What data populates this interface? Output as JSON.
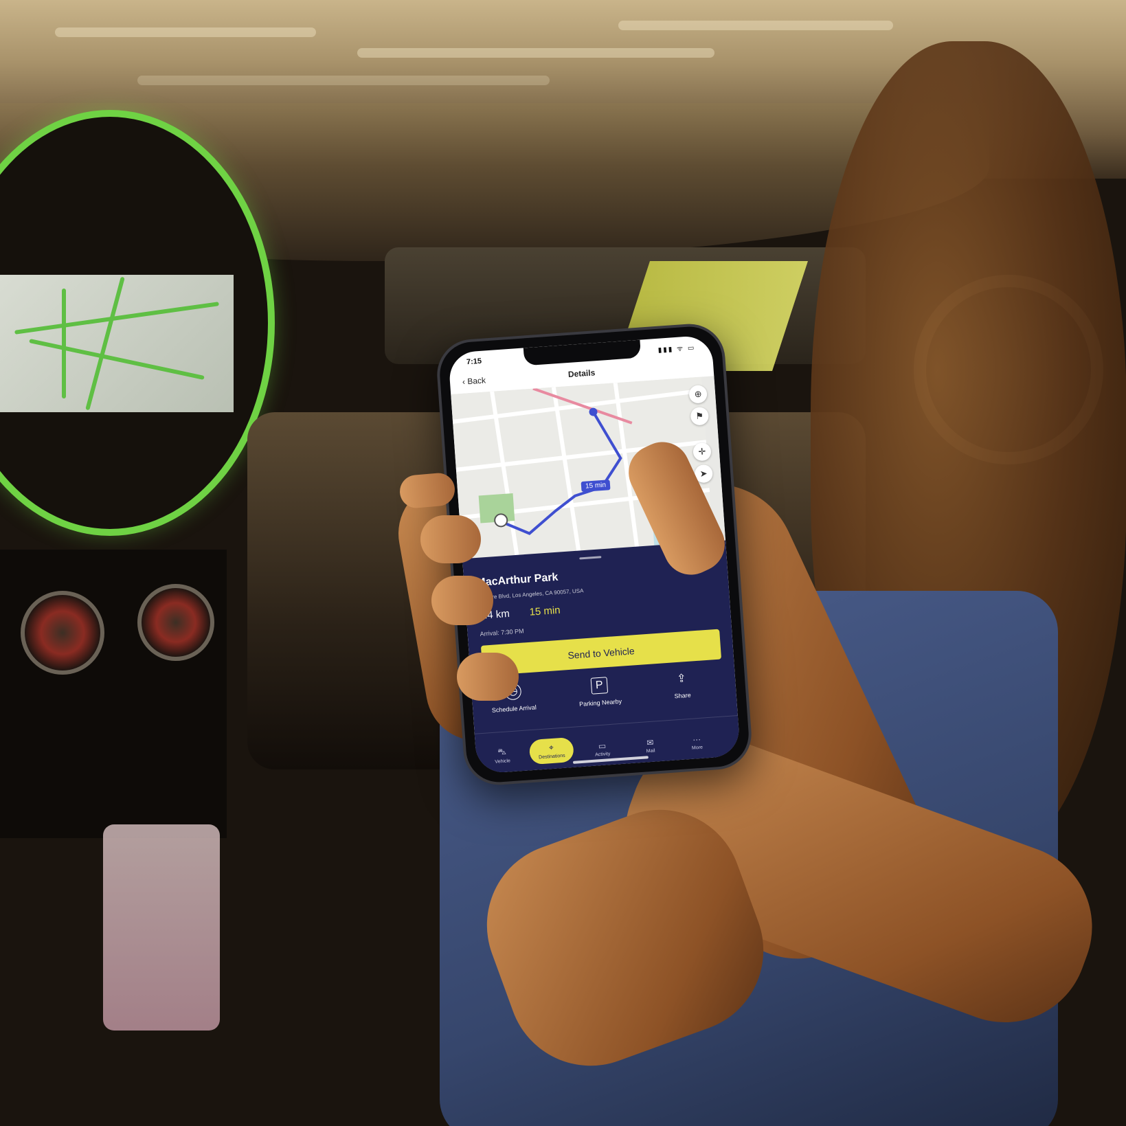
{
  "status_bar": {
    "time": "7:15",
    "icons": "▮▮▮ ᯤ ▭"
  },
  "nav": {
    "back_label": "Back",
    "title": "Details"
  },
  "map": {
    "route_time_label": "15 min"
  },
  "destination": {
    "name": "MacArthur Park",
    "address": "Wilshire Blvd, Los Angeles, CA 90057, USA",
    "distance": "8.4 km",
    "duration": "15 min",
    "arrival": "Arrival: 7:30 PM"
  },
  "primary_action": {
    "label": "Send to Vehicle"
  },
  "quick_actions": [
    {
      "label": "Schedule Arrival",
      "icon": "clock-icon"
    },
    {
      "label": "Parking Nearby",
      "icon": "parking-icon"
    },
    {
      "label": "Share",
      "icon": "share-icon"
    }
  ],
  "tabs": [
    {
      "label": "Vehicle",
      "icon": "car-icon"
    },
    {
      "label": "Destinations",
      "icon": "pin-icon",
      "active": true
    },
    {
      "label": "Activity",
      "icon": "activity-icon"
    },
    {
      "label": "Mail",
      "icon": "mail-icon"
    },
    {
      "label": "More",
      "icon": "more-icon"
    }
  ],
  "colors": {
    "accent": "#e6e04a",
    "sheet": "#1f2253",
    "route": "#3f4fd0"
  }
}
